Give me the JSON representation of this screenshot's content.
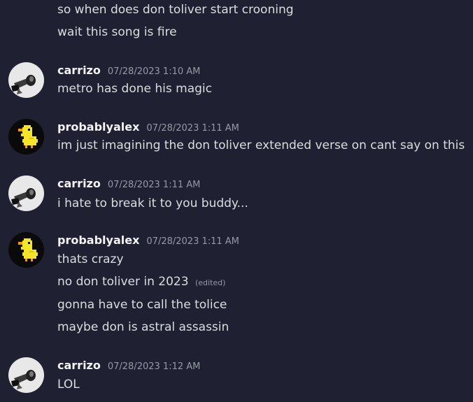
{
  "messages": [
    {
      "continuation": true,
      "lines": [
        "so when does don toliver start crooning",
        "wait this song is fire"
      ]
    },
    {
      "author": "carrizo",
      "timestamp": "07/28/2023 1:10 AM",
      "avatar": "carrizo-avatar",
      "lines": [
        "metro has done his magic"
      ]
    },
    {
      "author": "probablyalex",
      "timestamp": "07/28/2023 1:11 AM",
      "avatar": "duck-avatar",
      "lines": [
        "im just imagining the don toliver extended verse on cant say on this"
      ]
    },
    {
      "author": "carrizo",
      "timestamp": "07/28/2023 1:11 AM",
      "avatar": "carrizo-avatar",
      "lines": [
        "i hate to break it to you buddy..."
      ]
    },
    {
      "author": "probablyalex",
      "timestamp": "07/28/2023 1:11 AM",
      "avatar": "duck-avatar",
      "lines": [
        "thats crazy",
        "no don toliver in 2023",
        "gonna have to call the tolice",
        "maybe don is astral assassin"
      ],
      "edited_label": "(edited)"
    },
    {
      "author": "carrizo",
      "timestamp": "07/28/2023 1:12 AM",
      "avatar": "carrizo-avatar",
      "lines": [
        "LOL"
      ]
    }
  ],
  "colors": {
    "background": "#1f2031",
    "message_text": "#dbdee1",
    "username": "#f2f3f5",
    "timestamp": "#949ba4",
    "duck_yellow": "#f5e52a"
  }
}
